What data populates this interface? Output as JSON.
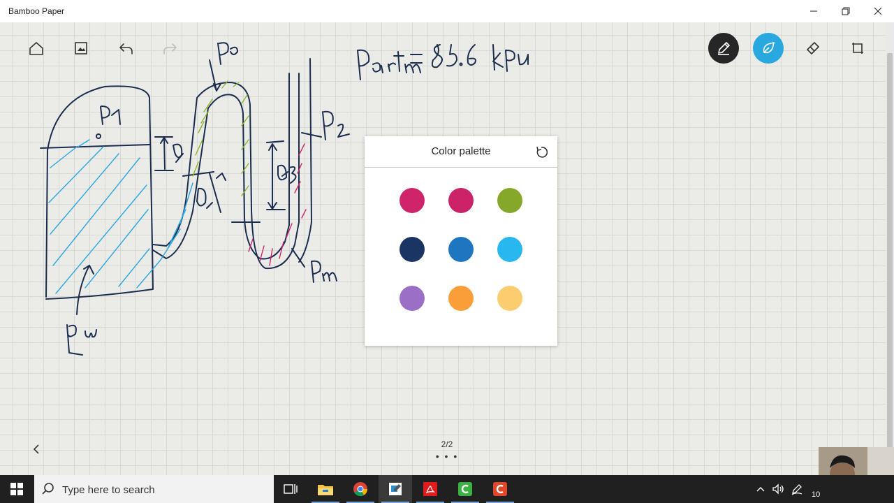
{
  "window": {
    "title": "Bamboo Paper"
  },
  "toolbar": {
    "left_icons": [
      "home-icon",
      "image-icon",
      "undo-icon",
      "redo-icon"
    ],
    "right_icons": [
      "pen-icon",
      "ink-drop-icon",
      "eraser-icon",
      "crop-icon"
    ]
  },
  "palette": {
    "title": "Color palette",
    "colors": [
      "#d0246a",
      "#cc2268",
      "#86a82a",
      "#1a3464",
      "#1f76c0",
      "#29b7f0",
      "#9b6fc6",
      "#f99e38",
      "#fbcd6e"
    ]
  },
  "page": {
    "indicator": "2/2",
    "more": "• • •"
  },
  "taskbar": {
    "search_placeholder": "Type here to search",
    "apps": [
      "task-view-icon",
      "file-explorer-icon",
      "chrome-icon",
      "bamboo-paper-icon",
      "acrobat-icon",
      "camtasia-recorder-icon",
      "camtasia-icon"
    ],
    "clock_fragment": "10"
  }
}
